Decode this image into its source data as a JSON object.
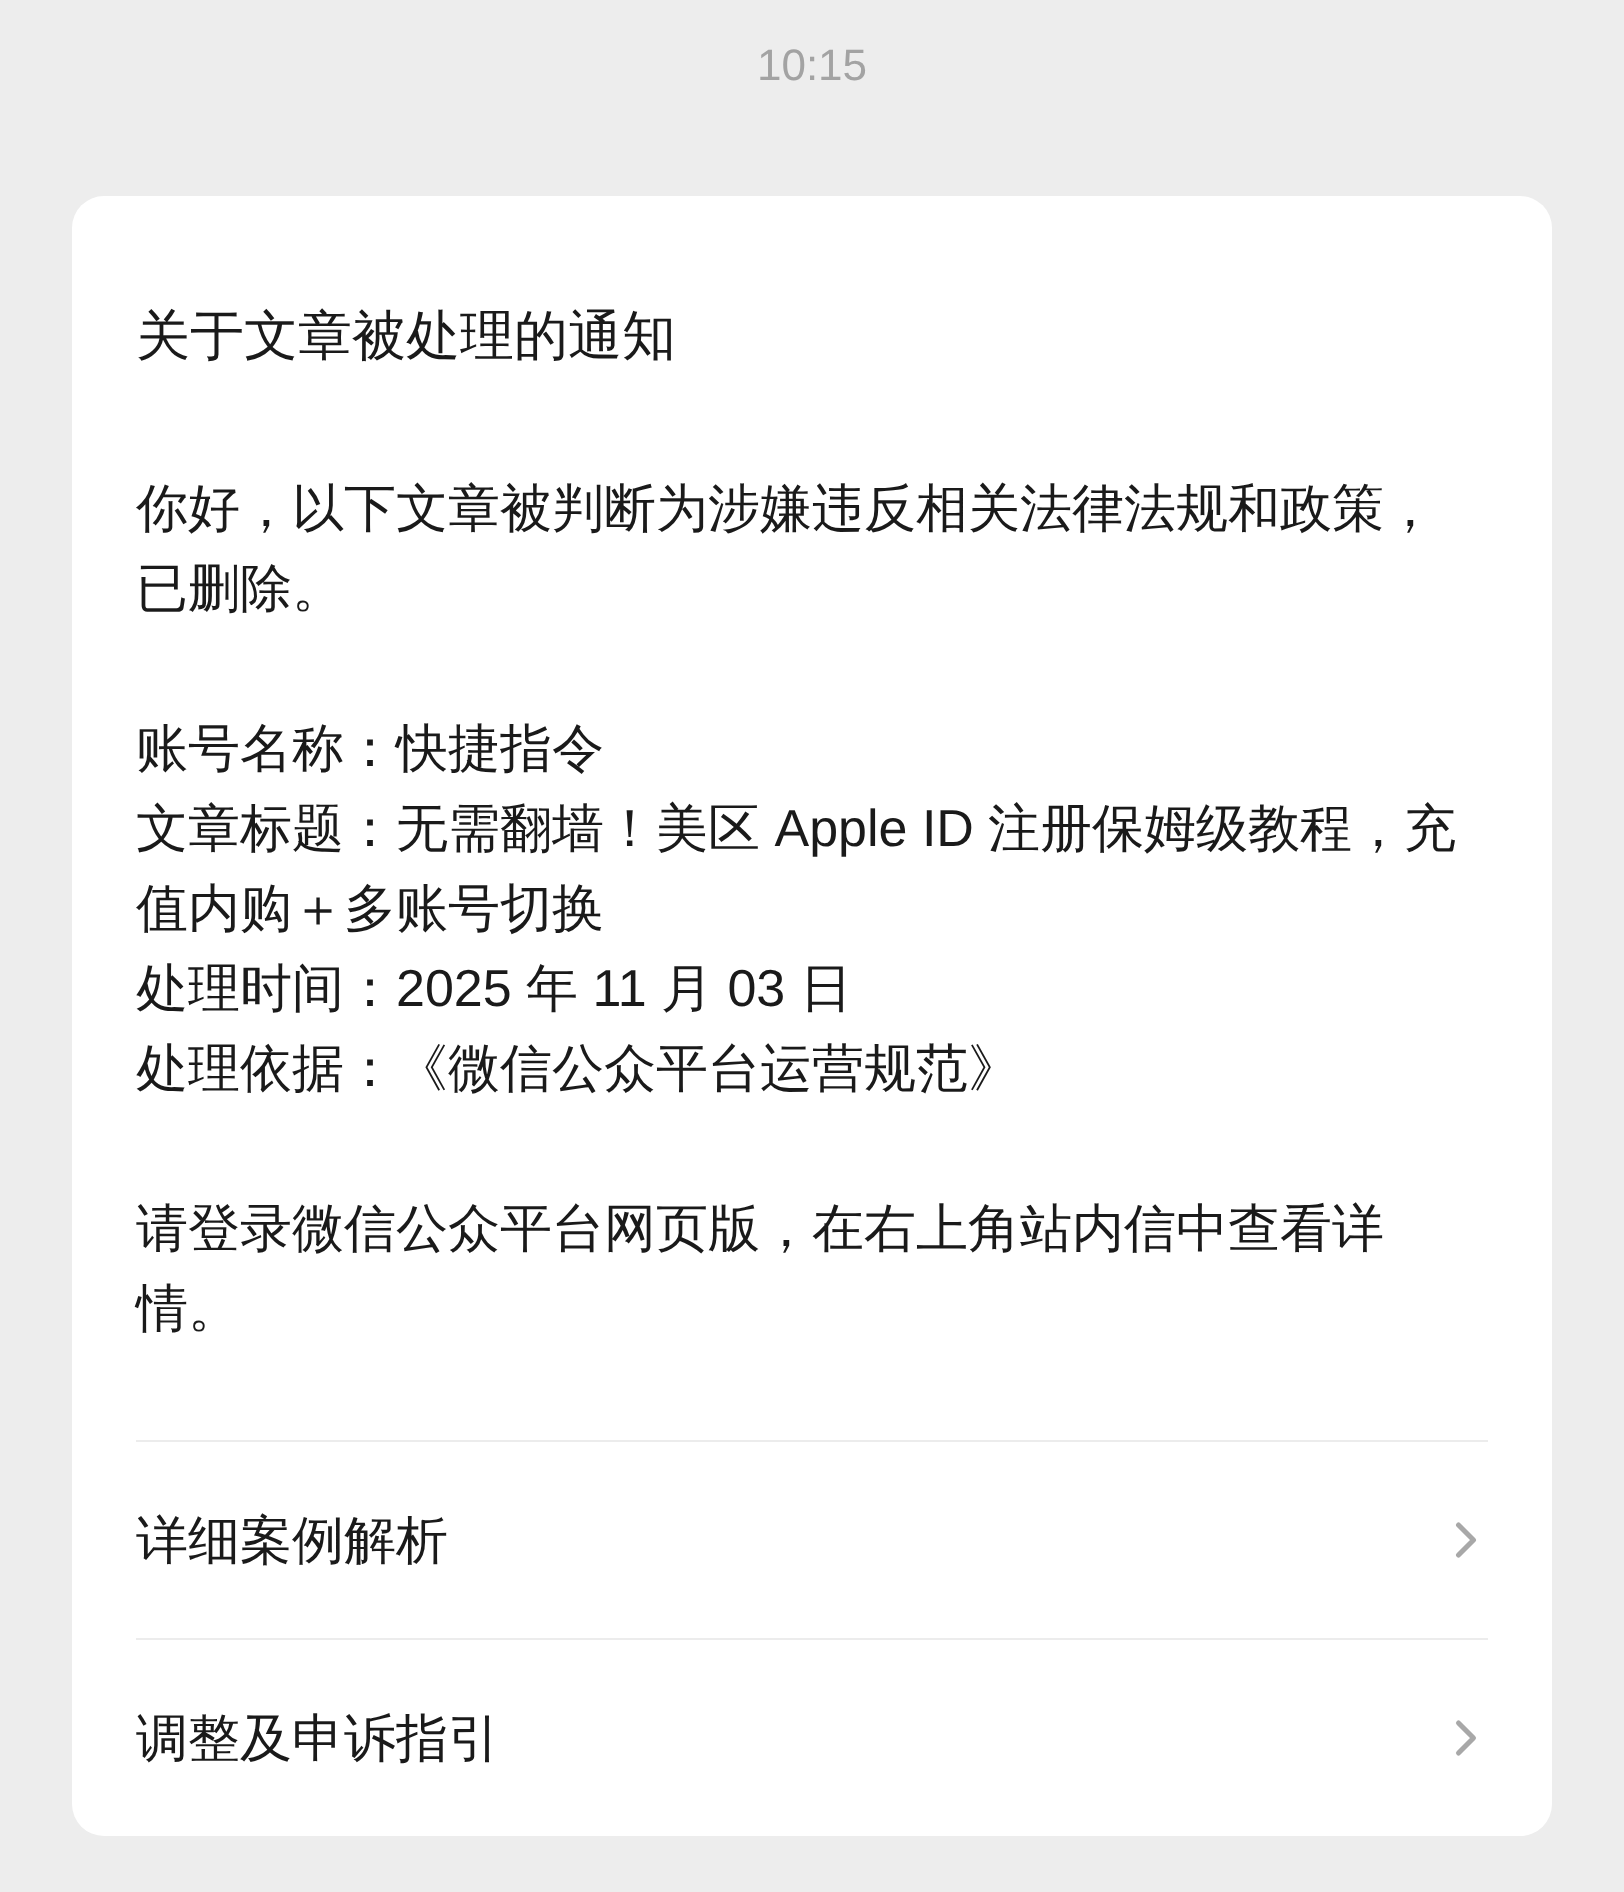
{
  "status_time": "10:15",
  "notice": {
    "title": "关于文章被处理的通知",
    "intro": "你好，以下文章被判断为涉嫌违反相关法律法规和政策，已删除。",
    "details": [
      "账号名称：快捷指令",
      "文章标题：无需翻墙！美区 Apple ID 注册保姆级教程，充值内购＋多账号切换",
      "处理时间：2025 年 11 月 03 日",
      "处理依据：《微信公众平台运营规范》"
    ],
    "footer": "请登录微信公众平台网页版，在右上角站内信中查看详情。",
    "links": [
      "详细案例解析",
      "调整及申诉指引"
    ]
  }
}
